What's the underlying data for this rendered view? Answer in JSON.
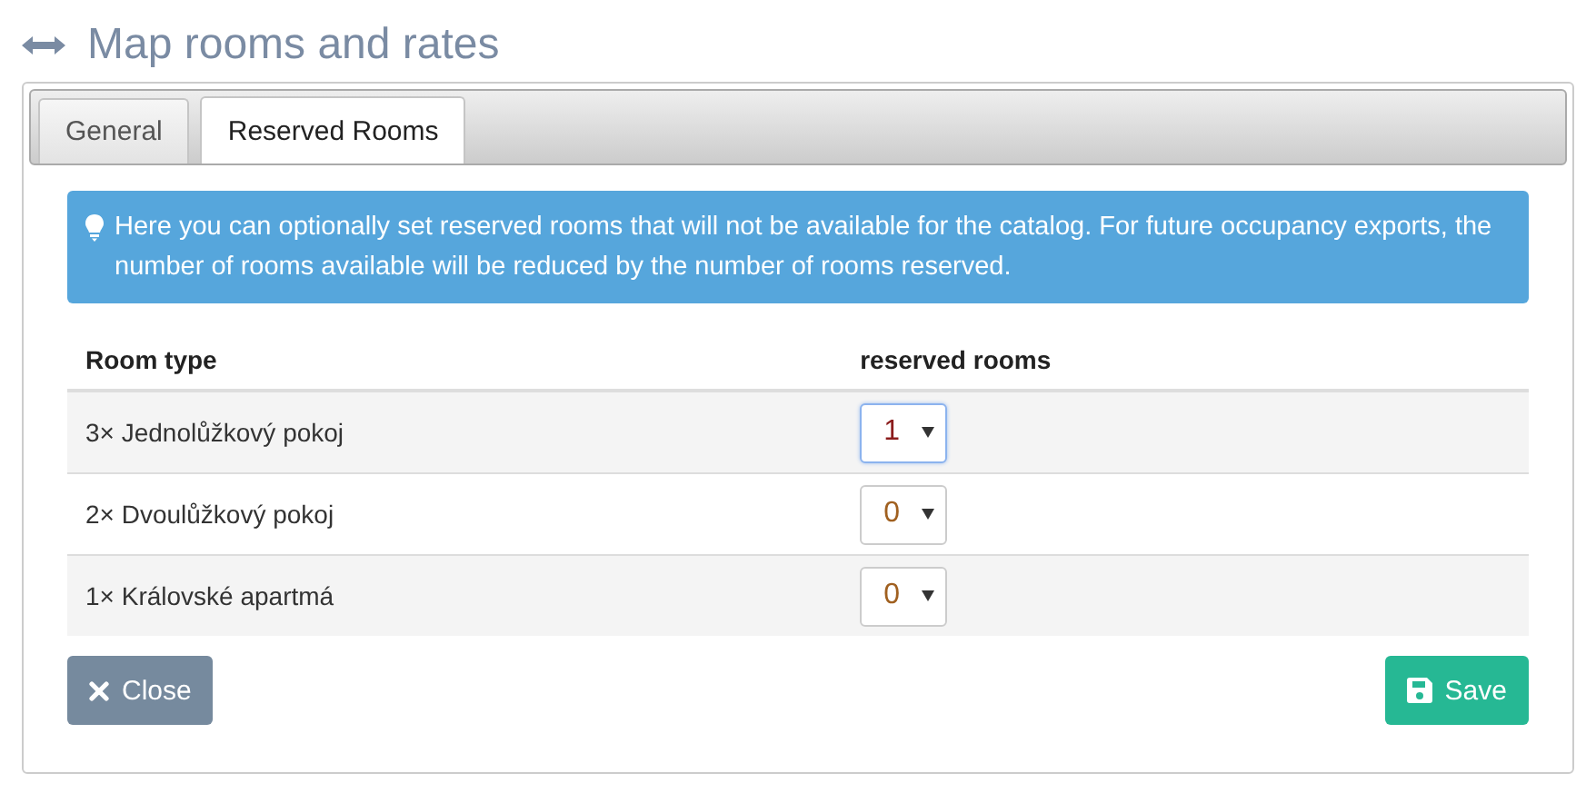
{
  "title": "Map rooms and rates",
  "tabs": [
    {
      "label": "General",
      "selected": false
    },
    {
      "label": "Reserved Rooms",
      "selected": true
    }
  ],
  "alert": "Here you can optionally set reserved rooms that will not be available for the catalog. For future occupancy exports, the number of rooms available will be reduced by the number of rooms reserved.",
  "table": {
    "columns": [
      "Room type",
      "reserved rooms"
    ],
    "rows": [
      {
        "room_type": "3× Jednolůžkový pokoj",
        "reserved": "1",
        "focused": true
      },
      {
        "room_type": "2× Dvoulůžkový pokoj",
        "reserved": "0",
        "focused": false
      },
      {
        "room_type": "1× Královské apartmá",
        "reserved": "0",
        "focused": false
      }
    ]
  },
  "buttons": [
    {
      "kind": "close",
      "label": "Close"
    },
    {
      "kind": "save",
      "label": "Save"
    }
  ]
}
